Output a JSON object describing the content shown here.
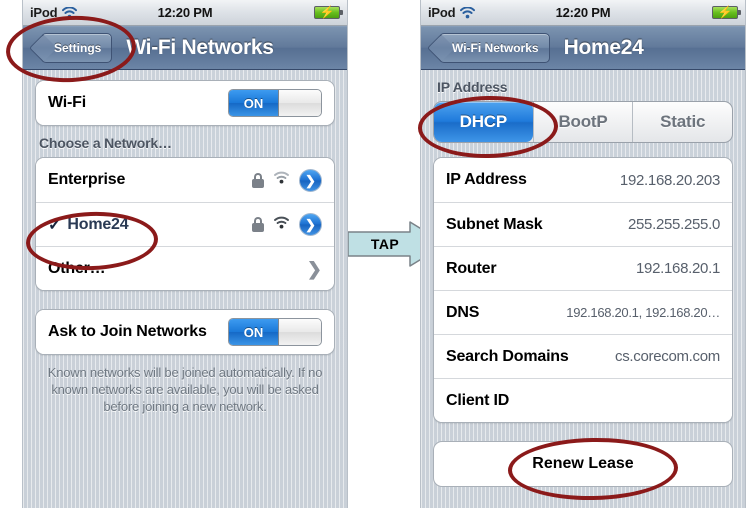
{
  "statusbar": {
    "carrier": "iPod",
    "time": "12:20 PM",
    "wifi_icon": "wifi-icon",
    "battery_icon": "battery-charging-icon"
  },
  "left_phone": {
    "nav": {
      "back_label": "Settings",
      "title": "Wi-Fi Networks"
    },
    "wifi_row": {
      "label": "Wi-Fi",
      "toggle_value": "ON"
    },
    "section_header": "Choose a Network…",
    "networks": [
      {
        "name": "Enterprise",
        "checked": false,
        "locked": true,
        "signal": 2,
        "accessory": "disclosure-blue"
      },
      {
        "name": "Home24",
        "checked": true,
        "check_glyph": "✓",
        "locked": true,
        "signal": 3,
        "accessory": "disclosure-blue"
      },
      {
        "name": "Other…",
        "checked": false,
        "locked": false,
        "signal": 0,
        "accessory": "chevron-gray"
      }
    ],
    "ask_row": {
      "label": "Ask to Join Networks",
      "toggle_value": "ON"
    },
    "footnote": "Known networks will be joined automatically. If no known networks are available, you will be asked before joining a new network."
  },
  "tap_annotation": {
    "label": "TAP",
    "fill_color": "#bfe0e4",
    "stroke_color": "#7a8288"
  },
  "right_phone": {
    "nav": {
      "back_label": "Wi-Fi Networks",
      "title": "Home24"
    },
    "section_header": "IP Address",
    "segments": [
      {
        "label": "DHCP",
        "selected": true
      },
      {
        "label": "BootP",
        "selected": false
      },
      {
        "label": "Static",
        "selected": false
      }
    ],
    "details": [
      {
        "label": "IP Address",
        "value": "192.168.20.203"
      },
      {
        "label": "Subnet Mask",
        "value": "255.255.255.0"
      },
      {
        "label": "Router",
        "value": "192.168.20.1"
      },
      {
        "label": "DNS",
        "value": "192.168.20.1, 192.168.20…"
      },
      {
        "label": "Search Domains",
        "value": "cs.corecom.com"
      },
      {
        "label": "Client ID",
        "value": ""
      }
    ],
    "renew_button": "Renew Lease"
  },
  "annotations": {
    "ellipse_color": "#8b1a1a",
    "targets": [
      "settings-back-button",
      "home24-network-row",
      "dhcp-segment",
      "renew-lease-button"
    ]
  }
}
